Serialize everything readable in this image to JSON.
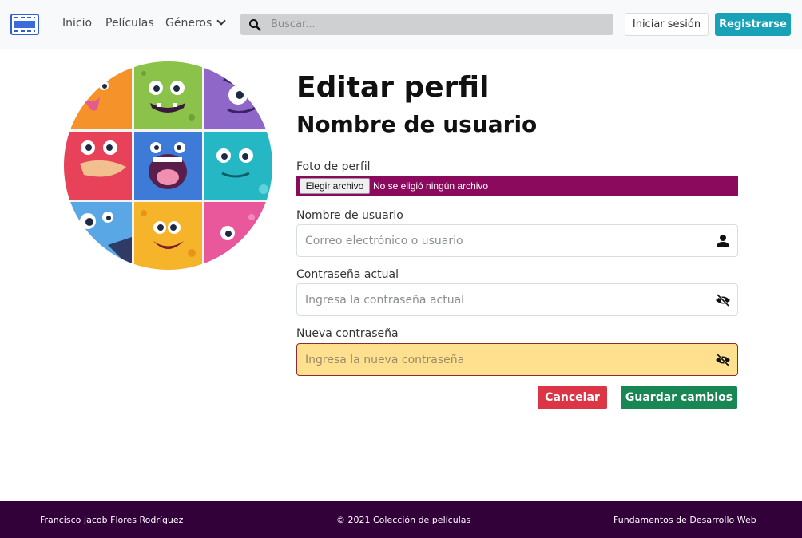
{
  "navbar": {
    "links": {
      "home": "Inicio",
      "movies": "Películas",
      "genres": "Géneros"
    },
    "search": {
      "placeholder": "Buscar..."
    },
    "login_label": "Iniciar sesión",
    "register_label": "Registrarse"
  },
  "profile": {
    "title": "Editar perfil",
    "username_heading": "Nombre de usuario",
    "photo_label": "Foto de perfil",
    "file_button_label": "Elegir archivo",
    "file_status": "No se eligió ningún archivo",
    "username_label": "Nombre de usuario",
    "username_placeholder": "Correo electrónico o usuario",
    "current_password_label": "Contraseña actual",
    "current_password_placeholder": "Ingresa la contraseña actual",
    "new_password_label": "Nueva contraseña",
    "new_password_placeholder": "Ingresa la nueva contraseña",
    "cancel_label": "Cancelar",
    "save_label": "Guardar cambios"
  },
  "footer": {
    "author": "Francisco Jacob Flores Rodríguez",
    "copyright": "© 2021 Colección de películas",
    "course": "Fundamentos de Desarrollo Web"
  },
  "icons": {
    "logo": "film-strip-icon",
    "search": "search-icon",
    "genres_toggle": "chevron-down-icon",
    "username": "user-icon",
    "password": "eye-slash-icon"
  },
  "colors": {
    "navbar_bg": "#f8f9fa",
    "register_button": "#17a2b8",
    "file_bar": "#8b0a5e",
    "new_password_bg": "#ffe08e",
    "cancel_button": "#dc3545",
    "save_button": "#198754",
    "footer_bg": "#33013a"
  }
}
